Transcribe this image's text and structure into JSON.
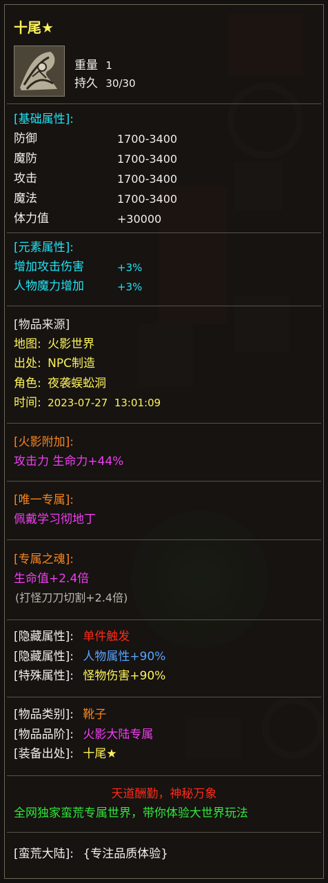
{
  "item": {
    "name": "十尾★",
    "weight_label": "重量",
    "weight_value": "1",
    "durability_label": "持久",
    "durability_value": "30/30"
  },
  "basic_attrs": {
    "header": "[基础属性]:",
    "rows": [
      {
        "label": "防御",
        "value": "1700-3400"
      },
      {
        "label": "魔防",
        "value": "1700-3400"
      },
      {
        "label": "攻击",
        "value": "1700-3400"
      },
      {
        "label": "魔法",
        "value": "1700-3400"
      },
      {
        "label": "体力值",
        "value": "+30000"
      }
    ]
  },
  "element_attrs": {
    "header": "[元素属性]:",
    "rows": [
      {
        "label": "增加攻击伤害",
        "value": "+3%"
      },
      {
        "label": "人物魔力增加",
        "value": "+3%"
      }
    ]
  },
  "source": {
    "header": "[物品来源]",
    "rows": [
      {
        "label": "地图:",
        "value": "火影世界"
      },
      {
        "label": "出处:",
        "value": "NPC制造"
      },
      {
        "label": "角色:",
        "value": "夜袭蜈蚣洞"
      },
      {
        "label": "时间:",
        "value": "2023-07-27  13:01:09"
      }
    ]
  },
  "huoying_addon": {
    "header": "[火影附加]:",
    "text": "攻击力 生命力+44%"
  },
  "exclusive": {
    "header": "[唯一专属]:",
    "text": "佩戴学习彻地丁"
  },
  "soul": {
    "header": "[专属之魂]:",
    "text": "生命值+2.4倍",
    "note": "(打怪刀刀切割+2.4倍)"
  },
  "hidden_attrs": [
    {
      "label": "[隐藏属性]:",
      "value": "单件触发",
      "color": "#ff2a18"
    },
    {
      "label": "[隐藏属性]:",
      "value": "人物属性+90%",
      "color": "#5aa4ff"
    },
    {
      "label": "[特殊属性]:",
      "value": "怪物伤害+90%",
      "color": "#fff45a"
    }
  ],
  "item_info": [
    {
      "label": "[物品类别]:",
      "value": "靴子",
      "color": "#f8851e"
    },
    {
      "label": "[物品品阶]:",
      "value": "火影大陆专属",
      "color": "#f23ef2"
    },
    {
      "label": "[装备出处]:",
      "value": "十尾★",
      "color": "#fff45a"
    }
  ],
  "slogan": {
    "line1": "天道酬勤，神秘万象",
    "line2": "全网独家蛮荒专属世界，带你体验大世界玩法"
  },
  "footer": {
    "label": "[蛮荒大陆]:",
    "value": "{专注品质体验}"
  },
  "icon": "boots-item-icon"
}
